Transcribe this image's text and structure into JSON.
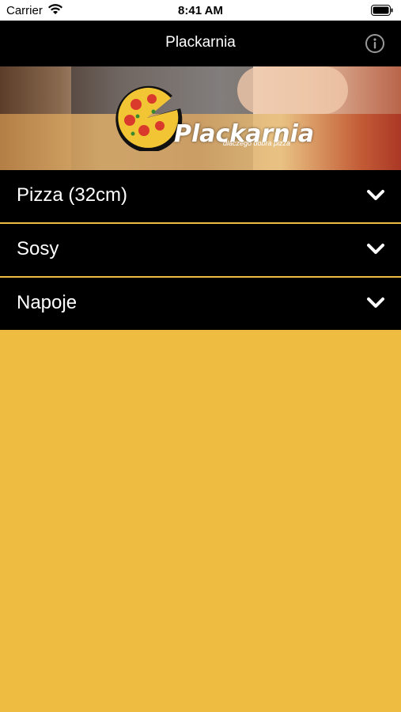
{
  "status_bar": {
    "carrier": "Carrier",
    "time": "8:41 AM"
  },
  "nav": {
    "title": "Plackarnia",
    "info_icon": "info-icon"
  },
  "banner": {
    "logo_text": "Plackarnia",
    "tagline": "dlaczego dobra pizza"
  },
  "menu": {
    "items": [
      {
        "label": "Pizza (32cm)",
        "icon": "chevron-down-icon"
      },
      {
        "label": "Sosy",
        "icon": "chevron-down-icon"
      },
      {
        "label": "Napoje",
        "icon": "chevron-down-icon"
      }
    ]
  },
  "colors": {
    "background": "#EDBC40",
    "nav": "#000000",
    "divider": "#EDBC40",
    "text": "#FFFFFF"
  }
}
